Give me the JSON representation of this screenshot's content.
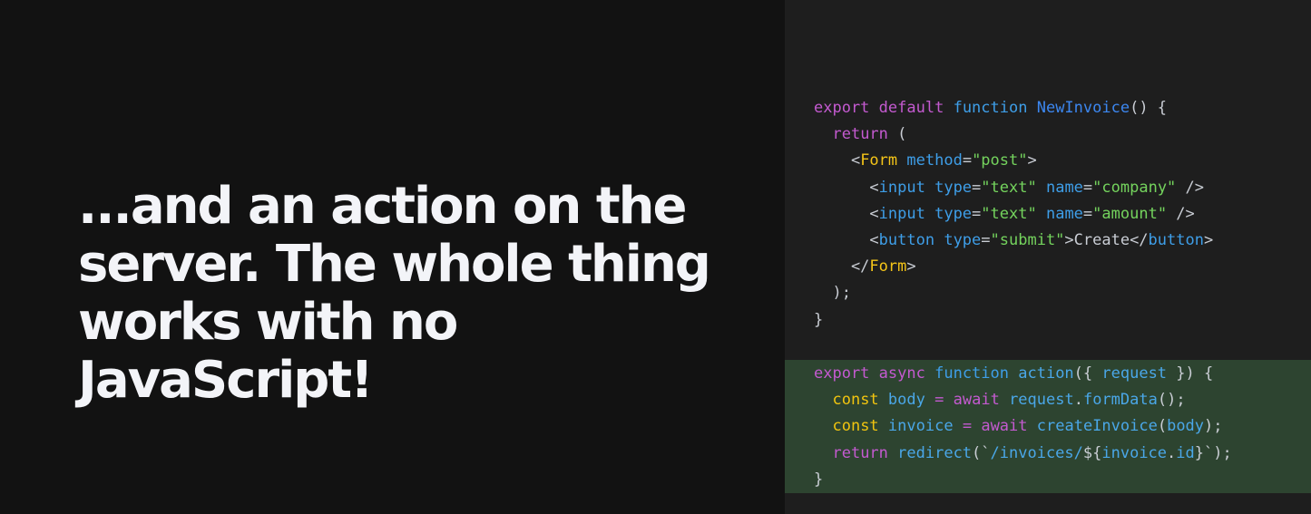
{
  "headline": "...and an action on the server. The whole thing works with no JavaScript!",
  "colors": {
    "background": "#121212",
    "code_panel": "#1e1e1e",
    "highlight": "#2d4430",
    "headline_text": "#f3f4f8"
  },
  "code": {
    "top": [
      [
        {
          "t": "export",
          "c": "kw-pink"
        },
        {
          "t": " ",
          "c": "plain"
        },
        {
          "t": "default",
          "c": "kw-pink"
        },
        {
          "t": " ",
          "c": "plain"
        },
        {
          "t": "function",
          "c": "kw-blue"
        },
        {
          "t": " ",
          "c": "plain"
        },
        {
          "t": "NewInvoice",
          "c": "fn"
        },
        {
          "t": "() {",
          "c": "plain"
        }
      ],
      [
        {
          "t": "  ",
          "c": "plain"
        },
        {
          "t": "return",
          "c": "kw-pink"
        },
        {
          "t": " (",
          "c": "plain"
        }
      ],
      [
        {
          "t": "    <",
          "c": "plain"
        },
        {
          "t": "Form",
          "c": "jsx"
        },
        {
          "t": " ",
          "c": "plain"
        },
        {
          "t": "method",
          "c": "attr"
        },
        {
          "t": "=",
          "c": "plain"
        },
        {
          "t": "\"post\"",
          "c": "str"
        },
        {
          "t": ">",
          "c": "plain"
        }
      ],
      [
        {
          "t": "      <",
          "c": "plain"
        },
        {
          "t": "input",
          "c": "attr"
        },
        {
          "t": " ",
          "c": "plain"
        },
        {
          "t": "type",
          "c": "attr"
        },
        {
          "t": "=",
          "c": "plain"
        },
        {
          "t": "\"text\"",
          "c": "str"
        },
        {
          "t": " ",
          "c": "plain"
        },
        {
          "t": "name",
          "c": "attr"
        },
        {
          "t": "=",
          "c": "plain"
        },
        {
          "t": "\"company\"",
          "c": "str"
        },
        {
          "t": " />",
          "c": "plain"
        }
      ],
      [
        {
          "t": "      <",
          "c": "plain"
        },
        {
          "t": "input",
          "c": "attr"
        },
        {
          "t": " ",
          "c": "plain"
        },
        {
          "t": "type",
          "c": "attr"
        },
        {
          "t": "=",
          "c": "plain"
        },
        {
          "t": "\"text\"",
          "c": "str"
        },
        {
          "t": " ",
          "c": "plain"
        },
        {
          "t": "name",
          "c": "attr"
        },
        {
          "t": "=",
          "c": "plain"
        },
        {
          "t": "\"amount\"",
          "c": "str"
        },
        {
          "t": " />",
          "c": "plain"
        }
      ],
      [
        {
          "t": "      <",
          "c": "plain"
        },
        {
          "t": "button",
          "c": "attr"
        },
        {
          "t": " ",
          "c": "plain"
        },
        {
          "t": "type",
          "c": "attr"
        },
        {
          "t": "=",
          "c": "plain"
        },
        {
          "t": "\"submit\"",
          "c": "str"
        },
        {
          "t": ">Create</",
          "c": "plain"
        },
        {
          "t": "button",
          "c": "attr"
        },
        {
          "t": ">",
          "c": "plain"
        }
      ],
      [
        {
          "t": "    </",
          "c": "plain"
        },
        {
          "t": "Form",
          "c": "jsx"
        },
        {
          "t": ">",
          "c": "plain"
        }
      ],
      [
        {
          "t": "  );",
          "c": "plain"
        }
      ],
      [
        {
          "t": "}",
          "c": "plain"
        }
      ]
    ],
    "bottom": [
      [
        {
          "t": "export",
          "c": "kw-pink"
        },
        {
          "t": " ",
          "c": "plain"
        },
        {
          "t": "async",
          "c": "kw-pink"
        },
        {
          "t": " ",
          "c": "plain"
        },
        {
          "t": "function",
          "c": "kw-blue"
        },
        {
          "t": " ",
          "c": "plain"
        },
        {
          "t": "action",
          "c": "var"
        },
        {
          "t": "({ ",
          "c": "plain"
        },
        {
          "t": "request",
          "c": "var"
        },
        {
          "t": " }) {",
          "c": "plain"
        }
      ],
      [
        {
          "t": "  ",
          "c": "plain"
        },
        {
          "t": "const",
          "c": "kw-yellow"
        },
        {
          "t": " ",
          "c": "plain"
        },
        {
          "t": "body",
          "c": "var"
        },
        {
          "t": " ",
          "c": "plain"
        },
        {
          "t": "=",
          "c": "kw-pink"
        },
        {
          "t": " ",
          "c": "plain"
        },
        {
          "t": "await",
          "c": "kw-pink"
        },
        {
          "t": " ",
          "c": "plain"
        },
        {
          "t": "request",
          "c": "var"
        },
        {
          "t": ".",
          "c": "plain"
        },
        {
          "t": "formData",
          "c": "var"
        },
        {
          "t": "();",
          "c": "plain"
        }
      ],
      [
        {
          "t": "  ",
          "c": "plain"
        },
        {
          "t": "const",
          "c": "kw-yellow"
        },
        {
          "t": " ",
          "c": "plain"
        },
        {
          "t": "invoice",
          "c": "var"
        },
        {
          "t": " ",
          "c": "plain"
        },
        {
          "t": "=",
          "c": "kw-pink"
        },
        {
          "t": " ",
          "c": "plain"
        },
        {
          "t": "await",
          "c": "kw-pink"
        },
        {
          "t": " ",
          "c": "plain"
        },
        {
          "t": "createInvoice",
          "c": "var"
        },
        {
          "t": "(",
          "c": "plain"
        },
        {
          "t": "body",
          "c": "var"
        },
        {
          "t": ");",
          "c": "plain"
        }
      ],
      [
        {
          "t": "  ",
          "c": "plain"
        },
        {
          "t": "return",
          "c": "kw-pink"
        },
        {
          "t": " ",
          "c": "plain"
        },
        {
          "t": "redirect",
          "c": "var"
        },
        {
          "t": "(`",
          "c": "plain"
        },
        {
          "t": "/invoices/",
          "c": "var"
        },
        {
          "t": "${",
          "c": "plain"
        },
        {
          "t": "invoice",
          "c": "var"
        },
        {
          "t": ".",
          "c": "plain"
        },
        {
          "t": "id",
          "c": "var"
        },
        {
          "t": "}`);",
          "c": "plain"
        }
      ],
      [
        {
          "t": "}",
          "c": "plain"
        }
      ]
    ]
  }
}
